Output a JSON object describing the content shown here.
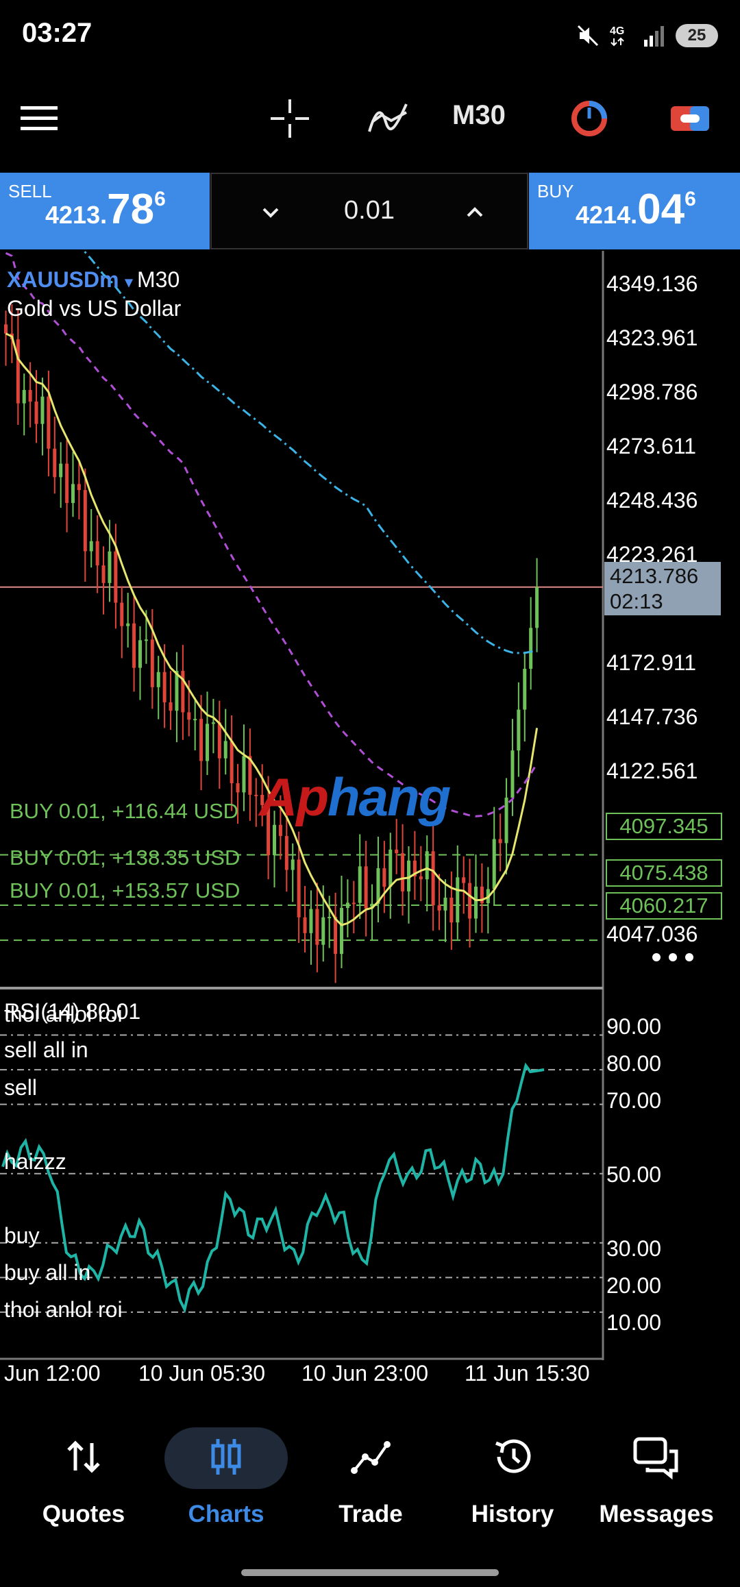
{
  "status_bar": {
    "time": "03:27",
    "battery": "25"
  },
  "toolbar": {
    "menu_icon": "hamburger-menu-icon",
    "crosshair_icon": "crosshair-icon",
    "indicators_icon": "indicators-icon",
    "timeframe": "M30",
    "timeframe_icon": "timeframe-clock-icon",
    "objects_icon": "objects-icon"
  },
  "trade_bar": {
    "sell": {
      "label": "SELL",
      "price_main": "4213.",
      "price_big": "78",
      "price_small": "6"
    },
    "buy": {
      "label": "BUY",
      "price_main": "4214.",
      "price_big": "04",
      "price_small": "6"
    },
    "lot": "0.01"
  },
  "chart": {
    "symbol": "XAUUSDm",
    "timeframe": "M30",
    "description": "Gold vs US Dollar",
    "price_scale": [
      "4349.136",
      "4323.961",
      "4298.786",
      "4273.611",
      "4248.436",
      "4223.261",
      "4172.911",
      "4147.736",
      "4122.561",
      "4047.036"
    ],
    "current_price": "4213.786",
    "countdown": "02:13",
    "orders": [
      {
        "label": "BUY 0.01,  +116.44 USD",
        "price": "4097.345"
      },
      {
        "label": "BUY 0.01,  +138.35 USD",
        "price": "4075.438"
      },
      {
        "label": "BUY 0.01,  +153.57 USD",
        "price": "4060.217"
      }
    ],
    "watermark_part1": "Ap",
    "watermark_part2": "hang",
    "more_icon": "more-dots-icon",
    "colors": {
      "up": "#6fc25a",
      "down": "#e0453a",
      "ma_fast": "#e6e66e",
      "ma_mid": "#b04fd6",
      "ma_slow": "#3bb3e6",
      "rsi": "#1fb5a6"
    }
  },
  "rsi": {
    "title": "RSI(14) 80.01",
    "levels": [
      "90.00",
      "80.00",
      "70.00",
      "50.00",
      "30.00",
      "20.00",
      "10.00"
    ],
    "labels": [
      "thoi anlol roi",
      "sell all in",
      "sell",
      "haizzz",
      "buy",
      "buy all in",
      "thoi anlol roi"
    ]
  },
  "time_axis": [
    "Jun 12:00",
    "10 Jun 05:30",
    "10 Jun 23:00",
    "11 Jun 15:30"
  ],
  "chart_data": {
    "type": "line",
    "title": "XAUUSDm M30 Gold vs US Dollar",
    "x": [
      "Jun 12:00",
      "10 Jun 05:30",
      "10 Jun 23:00",
      "11 Jun 15:30"
    ],
    "series": [
      {
        "name": "XAUUSDm",
        "values": [
          4318,
          4275,
          4230,
          4185,
          4160,
          4140,
          4110,
          4060,
          4080,
          4095,
          4075,
          4085,
          4213.786
        ]
      }
    ],
    "ylim": [
      4040,
      4360
    ],
    "rsi_values": [
      52,
      57,
      54,
      25,
      20,
      30,
      35,
      23,
      13,
      20,
      44,
      33,
      38,
      24,
      42,
      38,
      22,
      55,
      48,
      56,
      46,
      52,
      47,
      79,
      80.01
    ]
  },
  "nav": [
    {
      "label": "Quotes",
      "icon": "quotes-arrows-icon"
    },
    {
      "label": "Charts",
      "icon": "charts-candles-icon"
    },
    {
      "label": "Trade",
      "icon": "trade-line-icon"
    },
    {
      "label": "History",
      "icon": "history-clock-icon"
    },
    {
      "label": "Messages",
      "icon": "messages-bubbles-icon"
    }
  ]
}
